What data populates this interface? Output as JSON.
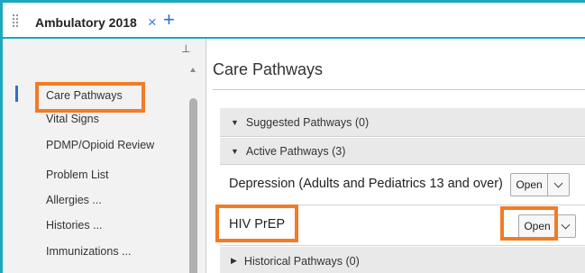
{
  "tab": {
    "title": "Ambulatory 2018",
    "close_glyph": "×",
    "add_glyph": "+"
  },
  "sidebar": {
    "pin_glyph": "⊥",
    "items": [
      {
        "label": "Care Pathways",
        "active": true
      },
      {
        "label": "Vital Signs"
      },
      {
        "label": "PDMP/Opioid Review"
      },
      {
        "label": "Problem List"
      },
      {
        "label": "Allergies ..."
      },
      {
        "label": "Histories ..."
      },
      {
        "label": "Immunizations ..."
      }
    ]
  },
  "main": {
    "title": "Care Pathways",
    "sections": {
      "suggested": "Suggested Pathways (0)",
      "active": "Active Pathways (3)",
      "historical": "Historical Pathways (0)"
    },
    "pathways": [
      {
        "name": "Depression (Adults and Pediatrics 13 and over)",
        "button": "Open"
      },
      {
        "name": "HIV PrEP",
        "button": "Open"
      }
    ]
  },
  "colors": {
    "accent": "#1aa9bf",
    "highlight": "#f07c28",
    "link": "#2f6fd0"
  },
  "icons": {
    "grip": "drag-grip-icon",
    "pin": "pin-icon",
    "caret_down": "caret-down-icon",
    "caret_right": "caret-right-icon",
    "chevron": "chevron-down-icon"
  }
}
